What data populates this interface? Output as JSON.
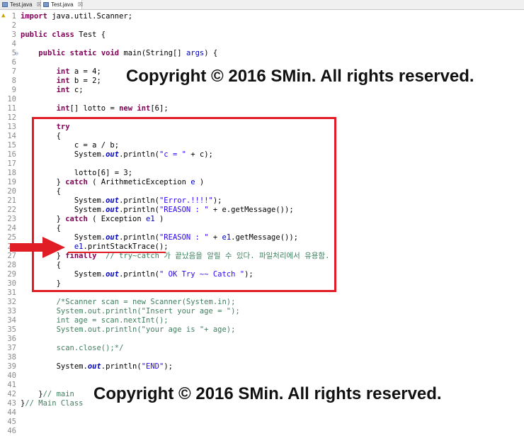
{
  "tabs": [
    {
      "label": "Test.java",
      "close": "☒"
    },
    {
      "label": "Test.java",
      "close": "☒"
    }
  ],
  "lines": [
    {
      "n": "1",
      "seg": [
        {
          "t": "import",
          "c": "kw"
        },
        {
          "t": " java.util.Scanner;",
          "c": ""
        }
      ]
    },
    {
      "n": "2",
      "seg": []
    },
    {
      "n": "3",
      "seg": [
        {
          "t": "public",
          "c": "kw"
        },
        {
          "t": " ",
          "c": ""
        },
        {
          "t": "class",
          "c": "kw"
        },
        {
          "t": " Test {",
          "c": ""
        }
      ]
    },
    {
      "n": "4",
      "seg": []
    },
    {
      "n": "5",
      "seg": [
        {
          "t": "    ",
          "c": ""
        },
        {
          "t": "public",
          "c": "kw"
        },
        {
          "t": " ",
          "c": ""
        },
        {
          "t": "static",
          "c": "kw"
        },
        {
          "t": " ",
          "c": ""
        },
        {
          "t": "void",
          "c": "kw"
        },
        {
          "t": " main(String[] ",
          "c": ""
        },
        {
          "t": "args",
          "c": "fieldc"
        },
        {
          "t": ") {",
          "c": ""
        }
      ]
    },
    {
      "n": "6",
      "seg": []
    },
    {
      "n": "7",
      "seg": [
        {
          "t": "        ",
          "c": ""
        },
        {
          "t": "int",
          "c": "kw"
        },
        {
          "t": " a = 4;",
          "c": ""
        }
      ]
    },
    {
      "n": "8",
      "seg": [
        {
          "t": "        ",
          "c": ""
        },
        {
          "t": "int",
          "c": "kw"
        },
        {
          "t": " b = 2;",
          "c": ""
        }
      ]
    },
    {
      "n": "9",
      "seg": [
        {
          "t": "        ",
          "c": ""
        },
        {
          "t": "int",
          "c": "kw"
        },
        {
          "t": " c;",
          "c": ""
        }
      ]
    },
    {
      "n": "10",
      "seg": []
    },
    {
      "n": "11",
      "seg": [
        {
          "t": "        ",
          "c": ""
        },
        {
          "t": "int",
          "c": "kw"
        },
        {
          "t": "[] lotto = ",
          "c": ""
        },
        {
          "t": "new",
          "c": "kw"
        },
        {
          "t": " ",
          "c": ""
        },
        {
          "t": "int",
          "c": "kw"
        },
        {
          "t": "[6];",
          "c": ""
        }
      ]
    },
    {
      "n": "12",
      "seg": []
    },
    {
      "n": "13",
      "seg": [
        {
          "t": "        ",
          "c": ""
        },
        {
          "t": "try",
          "c": "kw"
        }
      ]
    },
    {
      "n": "14",
      "seg": [
        {
          "t": "        {",
          "c": ""
        }
      ]
    },
    {
      "n": "15",
      "seg": [
        {
          "t": "            c = a / b;",
          "c": ""
        }
      ]
    },
    {
      "n": "16",
      "seg": [
        {
          "t": "            System.",
          "c": ""
        },
        {
          "t": "out",
          "c": "st"
        },
        {
          "t": ".println(",
          "c": ""
        },
        {
          "t": "\"c = \"",
          "c": "str"
        },
        {
          "t": " + c);",
          "c": ""
        }
      ]
    },
    {
      "n": "17",
      "seg": []
    },
    {
      "n": "18",
      "seg": [
        {
          "t": "            lotto[6] = 3;",
          "c": ""
        }
      ]
    },
    {
      "n": "19",
      "seg": [
        {
          "t": "        } ",
          "c": ""
        },
        {
          "t": "catch",
          "c": "kw"
        },
        {
          "t": " ( ArithmeticException ",
          "c": ""
        },
        {
          "t": "e",
          "c": "fieldc"
        },
        {
          "t": " )",
          "c": ""
        }
      ]
    },
    {
      "n": "20",
      "seg": [
        {
          "t": "        {",
          "c": ""
        }
      ]
    },
    {
      "n": "21",
      "seg": [
        {
          "t": "            System.",
          "c": ""
        },
        {
          "t": "out",
          "c": "st"
        },
        {
          "t": ".println(",
          "c": ""
        },
        {
          "t": "\"Error.!!!!\"",
          "c": "str"
        },
        {
          "t": ");",
          "c": ""
        }
      ]
    },
    {
      "n": "22",
      "seg": [
        {
          "t": "            System.",
          "c": ""
        },
        {
          "t": "out",
          "c": "st"
        },
        {
          "t": ".println(",
          "c": ""
        },
        {
          "t": "\"REASON : \"",
          "c": "str"
        },
        {
          "t": " + e.getMessage());",
          "c": ""
        }
      ]
    },
    {
      "n": "23",
      "seg": [
        {
          "t": "        } ",
          "c": ""
        },
        {
          "t": "catch",
          "c": "kw"
        },
        {
          "t": " ( Exception ",
          "c": ""
        },
        {
          "t": "e1",
          "c": "fieldc"
        },
        {
          "t": " )",
          "c": ""
        }
      ]
    },
    {
      "n": "24",
      "seg": [
        {
          "t": "        {",
          "c": ""
        }
      ]
    },
    {
      "n": "25",
      "seg": [
        {
          "t": "            System.",
          "c": ""
        },
        {
          "t": "out",
          "c": "st"
        },
        {
          "t": ".println(",
          "c": ""
        },
        {
          "t": "\"REASON : \"",
          "c": "str"
        },
        {
          "t": " + ",
          "c": ""
        },
        {
          "t": "e1",
          "c": "fieldc"
        },
        {
          "t": ".getMessage());",
          "c": ""
        }
      ]
    },
    {
      "n": "26",
      "seg": [
        {
          "t": "            ",
          "c": ""
        },
        {
          "t": "e1",
          "c": "fieldc"
        },
        {
          "t": ".printStackTrace();",
          "c": ""
        }
      ]
    },
    {
      "n": "27",
      "seg": [
        {
          "t": "        } ",
          "c": ""
        },
        {
          "t": "finally",
          "c": "kw"
        },
        {
          "t": "  // try~catch 가 끝났음을 알릴 수 있다. 파일처리에서 유용함.",
          "c": "cm"
        }
      ]
    },
    {
      "n": "28",
      "seg": [
        {
          "t": "        {",
          "c": ""
        }
      ]
    },
    {
      "n": "29",
      "seg": [
        {
          "t": "            System.",
          "c": ""
        },
        {
          "t": "out",
          "c": "st"
        },
        {
          "t": ".println(",
          "c": ""
        },
        {
          "t": "\" OK Try ~~ Catch \"",
          "c": "str"
        },
        {
          "t": ");",
          "c": ""
        }
      ]
    },
    {
      "n": "30",
      "seg": [
        {
          "t": "        }",
          "c": ""
        }
      ]
    },
    {
      "n": "31",
      "seg": []
    },
    {
      "n": "32",
      "seg": [
        {
          "t": "        /*Scanner scan = new Scanner(System.in);",
          "c": "cm"
        }
      ]
    },
    {
      "n": "33",
      "seg": [
        {
          "t": "        System.out.println(\"Insert your age = \");",
          "c": "cm"
        }
      ]
    },
    {
      "n": "34",
      "seg": [
        {
          "t": "        int age = scan.nextInt();",
          "c": "cm"
        }
      ]
    },
    {
      "n": "35",
      "seg": [
        {
          "t": "        System.out.println(\"your age is \"+ age);",
          "c": "cm"
        }
      ]
    },
    {
      "n": "36",
      "seg": []
    },
    {
      "n": "37",
      "seg": [
        {
          "t": "        scan.close();*/",
          "c": "cm"
        }
      ]
    },
    {
      "n": "38",
      "seg": []
    },
    {
      "n": "39",
      "seg": [
        {
          "t": "        System.",
          "c": ""
        },
        {
          "t": "out",
          "c": "st"
        },
        {
          "t": ".println(",
          "c": ""
        },
        {
          "t": "\"END\"",
          "c": "str"
        },
        {
          "t": ");",
          "c": ""
        }
      ]
    },
    {
      "n": "40",
      "seg": []
    },
    {
      "n": "41",
      "seg": []
    },
    {
      "n": "42",
      "seg": [
        {
          "t": "    }",
          "c": ""
        },
        {
          "t": "// main",
          "c": "cm"
        }
      ]
    },
    {
      "n": "43",
      "seg": [
        {
          "t": "}",
          "c": ""
        },
        {
          "t": "// Main Class",
          "c": "cm"
        }
      ]
    },
    {
      "n": "44",
      "seg": []
    },
    {
      "n": "45",
      "seg": []
    },
    {
      "n": "46",
      "seg": []
    }
  ],
  "watermark": {
    "top": "Copyright © 2016 SMin. All rights reserved.",
    "bottom": "Copyright © 2016 SMin. All rights reserved."
  },
  "colors": {
    "highlight": "#e01c24"
  }
}
